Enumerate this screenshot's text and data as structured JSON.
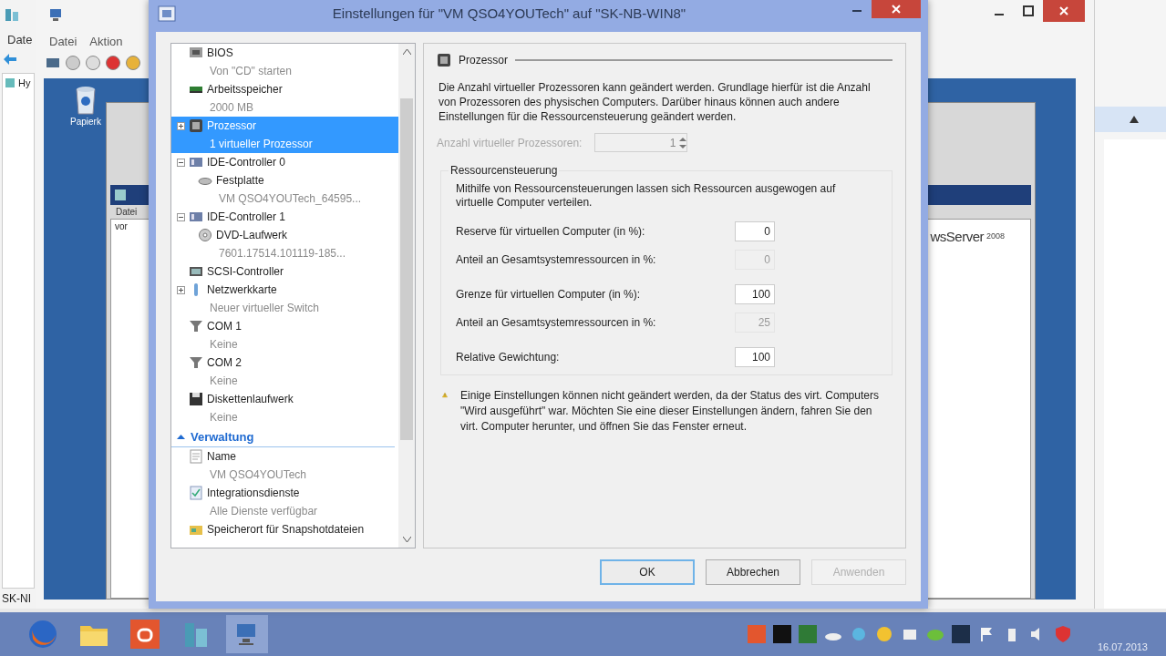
{
  "left_window": {
    "menu": "Date",
    "tree_item": "Hy",
    "status": "SK-NI"
  },
  "vm_window": {
    "menu": [
      "Datei",
      "Aktion"
    ],
    "desktop_icon_label": "Papierk",
    "inner_menu": "Datei",
    "inner_text": "vor",
    "brand": "wsServer",
    "version": "2008"
  },
  "dialog": {
    "title": "Einstellungen für \"VM QSO4YOUTech\" auf \"SK-NB-WIN8\"",
    "tree": [
      {
        "kind": "item",
        "label": "BIOS",
        "detail": "Von \"CD\" starten",
        "selected": false
      },
      {
        "kind": "item",
        "label": "Arbeitsspeicher",
        "detail": "2000 MB",
        "selected": false
      },
      {
        "kind": "item",
        "label": "Prozessor",
        "detail": "1 virtueller Prozessor",
        "selected": true,
        "expanded": false
      },
      {
        "kind": "item",
        "label": "IDE-Controller 0",
        "selected": false,
        "expanded": true,
        "children": [
          {
            "kind": "item",
            "label": "Festplatte",
            "detail": "VM QSO4YOUTech_64595...",
            "selected": false
          }
        ]
      },
      {
        "kind": "item",
        "label": "IDE-Controller 1",
        "selected": false,
        "expanded": true,
        "children": [
          {
            "kind": "item",
            "label": "DVD-Laufwerk",
            "detail": "7601.17514.101119-185...",
            "selected": false
          }
        ]
      },
      {
        "kind": "item",
        "label": "SCSI-Controller",
        "selected": false
      },
      {
        "kind": "item",
        "label": "Netzwerkkarte",
        "detail": "Neuer virtueller Switch",
        "selected": false,
        "expanded": false
      },
      {
        "kind": "item",
        "label": "COM 1",
        "detail": "Keine",
        "selected": false
      },
      {
        "kind": "item",
        "label": "COM 2",
        "detail": "Keine",
        "selected": false
      },
      {
        "kind": "item",
        "label": "Diskettenlaufwerk",
        "detail": "Keine",
        "selected": false
      },
      {
        "kind": "section",
        "label": "Verwaltung",
        "expanded": true,
        "children": [
          {
            "kind": "item",
            "label": "Name",
            "detail": "VM QSO4YOUTech",
            "selected": false
          },
          {
            "kind": "item",
            "label": "Integrationsdienste",
            "detail": "Alle Dienste verfügbar",
            "selected": false
          },
          {
            "kind": "item",
            "label": "Speicherort für Snapshotdateien",
            "selected": false
          }
        ]
      }
    ],
    "panel": {
      "title": "Prozessor",
      "description": "Die Anzahl virtueller Prozessoren kann geändert werden. Grundlage hierfür ist die Anzahl von Prozessoren des physischen Computers. Darüber hinaus können auch andere Einstellungen für die Ressourcensteuerung geändert werden.",
      "processor_count": {
        "label": "Anzahl virtueller Prozessoren:",
        "value": "1",
        "disabled": true
      },
      "resource_group": {
        "title": "Ressourcensteuerung",
        "description": "Mithilfe von Ressourcensteuerungen lassen sich Ressourcen ausgewogen auf virtuelle Computer verteilen.",
        "fields": [
          {
            "label": "Reserve für virtuellen Computer (in %):",
            "value": "0",
            "disabled": false
          },
          {
            "label": "Anteil an Gesamtsystemressourcen in %:",
            "value": "0",
            "disabled": true
          },
          {
            "label": "Grenze für virtuellen Computer (in %):",
            "value": "100",
            "disabled": false
          },
          {
            "label": "Anteil an Gesamtsystemressourcen in %:",
            "value": "25",
            "disabled": true
          },
          {
            "label": "Relative Gewichtung:",
            "value": "100",
            "disabled": false
          }
        ]
      },
      "warning": "Einige Einstellungen können nicht geändert werden, da der Status des virt. Computers \"Wird ausgeführt\" war. Möchten Sie eine dieser Einstellungen ändern, fahren Sie den virt. Computer herunter, und öffnen Sie das Fenster erneut."
    },
    "buttons": [
      {
        "label": "OK",
        "default": true,
        "disabled": false
      },
      {
        "label": "Abbrechen",
        "default": false,
        "disabled": false
      },
      {
        "label": "Anwenden",
        "default": false,
        "disabled": true
      }
    ]
  },
  "taskbar": {
    "date": "16.07.2013"
  }
}
